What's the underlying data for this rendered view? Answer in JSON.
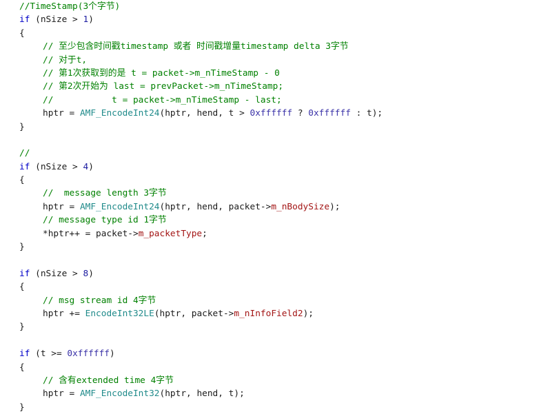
{
  "view": {
    "name": "code-snippet-view",
    "language": "C++",
    "background_color": "#ffffff",
    "font_size_px": 12.8,
    "line_height_px": 19.4
  },
  "theme": {
    "plain": "#1a1a1a",
    "comment": "#008000",
    "keyword": "#0000c8",
    "function": "#1f8a8a",
    "member": "#a31515",
    "number": "#1a1aa0",
    "hex": "#3b33a8"
  },
  "code": {
    "lines": [
      {
        "indent": 0,
        "tokens": [
          {
            "t": "comment",
            "s": "//TimeStamp(3个字节)"
          }
        ]
      },
      {
        "indent": 0,
        "tokens": [
          {
            "t": "keyword",
            "s": "if"
          },
          {
            "t": "plain",
            "s": " (nSize > "
          },
          {
            "t": "number",
            "s": "1"
          },
          {
            "t": "plain",
            "s": ")"
          }
        ]
      },
      {
        "indent": 0,
        "tokens": [
          {
            "t": "brace",
            "s": "{"
          }
        ]
      },
      {
        "indent": 1,
        "tokens": [
          {
            "t": "comment",
            "s": "// 至少包含时间戳timestamp 或者 时间戳增量timestamp delta 3字节"
          }
        ]
      },
      {
        "indent": 1,
        "tokens": [
          {
            "t": "comment",
            "s": "// 对于t,"
          }
        ]
      },
      {
        "indent": 1,
        "tokens": [
          {
            "t": "comment",
            "s": "// 第1次获取到的是 t = packet->m_nTimeStamp - 0"
          }
        ]
      },
      {
        "indent": 1,
        "tokens": [
          {
            "t": "comment",
            "s": "// 第2次开始为 last = prevPacket->m_nTimeStamp;"
          }
        ]
      },
      {
        "indent": 1,
        "tokens": [
          {
            "t": "comment",
            "s": "//           t = packet->m_nTimeStamp - last;"
          }
        ]
      },
      {
        "indent": 1,
        "tokens": [
          {
            "t": "plain",
            "s": "hptr = "
          },
          {
            "t": "func",
            "s": "AMF_EncodeInt24"
          },
          {
            "t": "plain",
            "s": "(hptr, hend, t > "
          },
          {
            "t": "hex",
            "s": "0xffffff"
          },
          {
            "t": "plain",
            "s": " ? "
          },
          {
            "t": "hex",
            "s": "0xffffff"
          },
          {
            "t": "plain",
            "s": " : t);"
          }
        ]
      },
      {
        "indent": 0,
        "tokens": [
          {
            "t": "brace",
            "s": "}"
          }
        ]
      },
      {
        "indent": 0,
        "tokens": []
      },
      {
        "indent": 0,
        "tokens": [
          {
            "t": "comment",
            "s": "//"
          }
        ]
      },
      {
        "indent": 0,
        "tokens": [
          {
            "t": "keyword",
            "s": "if"
          },
          {
            "t": "plain",
            "s": " (nSize > "
          },
          {
            "t": "number",
            "s": "4"
          },
          {
            "t": "plain",
            "s": ")"
          }
        ]
      },
      {
        "indent": 0,
        "tokens": [
          {
            "t": "brace",
            "s": "{"
          }
        ]
      },
      {
        "indent": 1,
        "tokens": [
          {
            "t": "comment",
            "s": "//  message length 3字节"
          }
        ]
      },
      {
        "indent": 1,
        "tokens": [
          {
            "t": "plain",
            "s": "hptr = "
          },
          {
            "t": "func",
            "s": "AMF_EncodeInt24"
          },
          {
            "t": "plain",
            "s": "(hptr, hend, packet->"
          },
          {
            "t": "member",
            "s": "m_nBodySize"
          },
          {
            "t": "plain",
            "s": ");"
          }
        ]
      },
      {
        "indent": 1,
        "tokens": [
          {
            "t": "comment",
            "s": "// message type id 1字节"
          }
        ]
      },
      {
        "indent": 1,
        "tokens": [
          {
            "t": "plain",
            "s": "*hptr++ = packet->"
          },
          {
            "t": "member",
            "s": "m_packetType"
          },
          {
            "t": "plain",
            "s": ";"
          }
        ]
      },
      {
        "indent": 0,
        "tokens": [
          {
            "t": "brace",
            "s": "}"
          }
        ]
      },
      {
        "indent": 0,
        "tokens": []
      },
      {
        "indent": 0,
        "tokens": [
          {
            "t": "keyword",
            "s": "if"
          },
          {
            "t": "plain",
            "s": " (nSize > "
          },
          {
            "t": "number",
            "s": "8"
          },
          {
            "t": "plain",
            "s": ")"
          }
        ]
      },
      {
        "indent": 0,
        "tokens": [
          {
            "t": "brace",
            "s": "{"
          }
        ]
      },
      {
        "indent": 1,
        "tokens": [
          {
            "t": "comment",
            "s": "// msg stream id 4字节"
          }
        ]
      },
      {
        "indent": 1,
        "tokens": [
          {
            "t": "plain",
            "s": "hptr += "
          },
          {
            "t": "func",
            "s": "EncodeInt32LE"
          },
          {
            "t": "plain",
            "s": "(hptr, packet->"
          },
          {
            "t": "member",
            "s": "m_nInfoField2"
          },
          {
            "t": "plain",
            "s": ");"
          }
        ]
      },
      {
        "indent": 0,
        "tokens": [
          {
            "t": "brace",
            "s": "}"
          }
        ]
      },
      {
        "indent": 0,
        "tokens": []
      },
      {
        "indent": 0,
        "tokens": [
          {
            "t": "keyword",
            "s": "if"
          },
          {
            "t": "plain",
            "s": " (t >= "
          },
          {
            "t": "hex",
            "s": "0xffffff"
          },
          {
            "t": "plain",
            "s": ")"
          }
        ]
      },
      {
        "indent": 0,
        "tokens": [
          {
            "t": "brace",
            "s": "{"
          }
        ]
      },
      {
        "indent": 1,
        "tokens": [
          {
            "t": "comment",
            "s": "// 含有extended time 4字节"
          }
        ]
      },
      {
        "indent": 1,
        "tokens": [
          {
            "t": "plain",
            "s": "hptr = "
          },
          {
            "t": "func",
            "s": "AMF_EncodeInt32"
          },
          {
            "t": "plain",
            "s": "(hptr, hend, t);"
          }
        ]
      },
      {
        "indent": 0,
        "tokens": [
          {
            "t": "brace",
            "s": "}"
          }
        ]
      }
    ]
  }
}
